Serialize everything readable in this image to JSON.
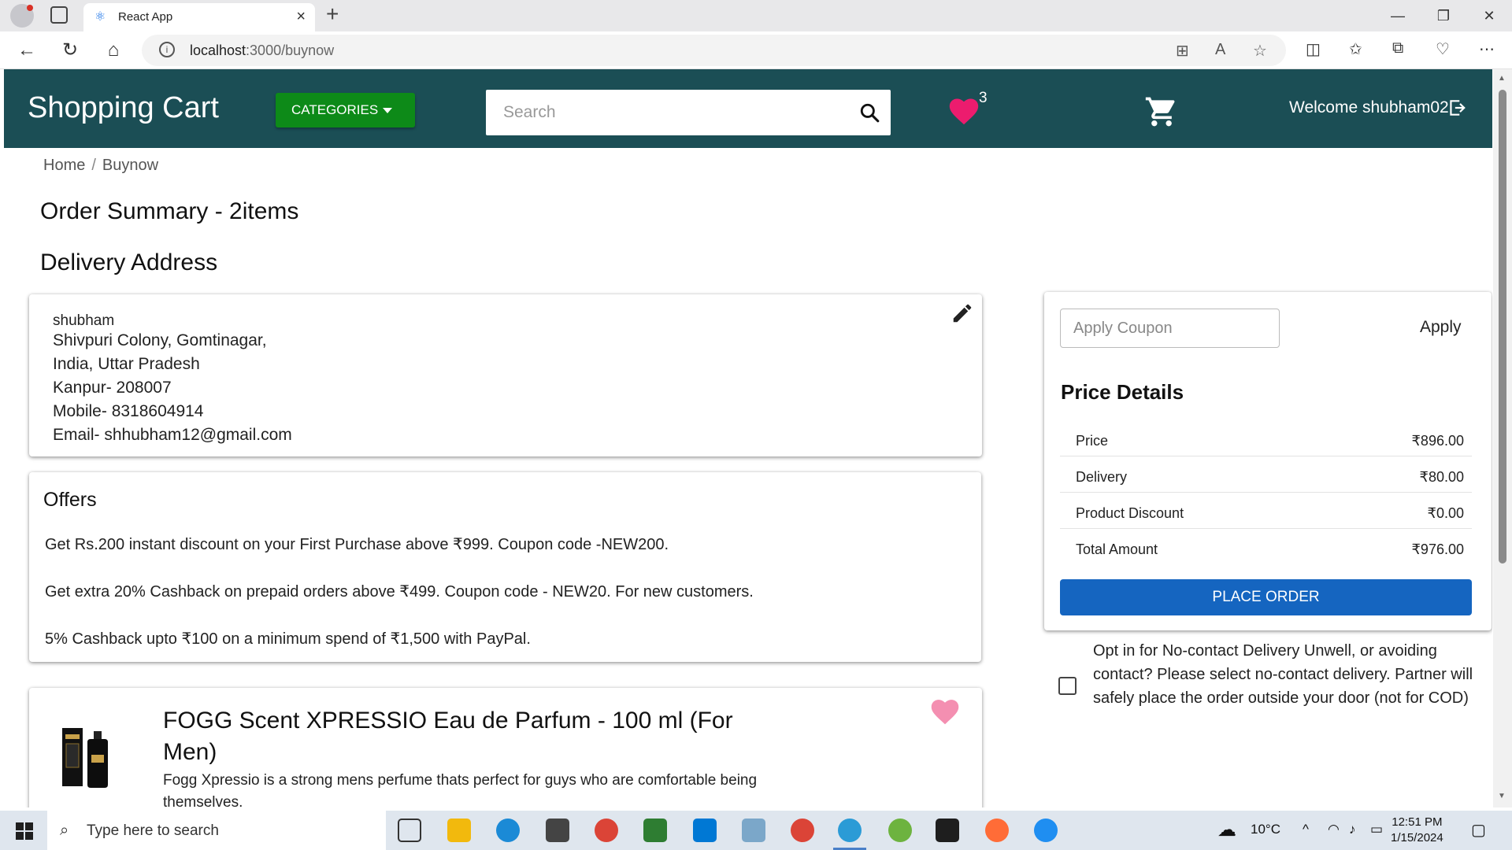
{
  "browser": {
    "tab_title": "React App",
    "url_host": "localhost",
    "url_path": ":3000/buynow"
  },
  "header": {
    "brand": "Shopping Cart",
    "categories_label": "CATEGORIES",
    "search_placeholder": "Search",
    "wishlist_count": "3",
    "welcome": "Welcome shubham02"
  },
  "breadcrumb": {
    "home": "Home",
    "current": "Buynow"
  },
  "order_summary_title": "Order Summary - 2items",
  "delivery_title": "Delivery Address",
  "address": {
    "name": "shubham",
    "line1": "Shivpuri Colony, Gomtinagar,",
    "line2": "India, Uttar Pradesh",
    "line3": "Kanpur- 208007",
    "mobile": "Mobile- 8318604914",
    "email": "Email- shhubham12@gmail.com"
  },
  "offers": {
    "title": "Offers",
    "items": [
      "Get Rs.200 instant discount on your First Purchase above ₹999. Coupon code -NEW200.",
      "Get extra 20% Cashback on prepaid orders above ₹499. Coupon code - NEW20. For new customers.",
      "5% Cashback upto ₹100 on a minimum spend of ₹1,500 with PayPal."
    ]
  },
  "product": {
    "title": "FOGG Scent XPRESSIO Eau de Parfum - 100 ml (For Men)",
    "description": "Fogg Xpressio is a strong mens perfume thats perfect for guys who are comfortable being themselves."
  },
  "price_panel": {
    "coupon_placeholder": "Apply Coupon",
    "apply_label": "Apply",
    "title": "Price Details",
    "rows": [
      {
        "label": "Price",
        "value": "₹896.00"
      },
      {
        "label": "Delivery",
        "value": "₹80.00"
      },
      {
        "label": "Product Discount",
        "value": "₹0.00"
      },
      {
        "label": "Total Amount",
        "value": "₹976.00"
      }
    ],
    "place_order": "PLACE ORDER"
  },
  "no_contact_text": "Opt in for No-contact Delivery Unwell, or avoiding contact? Please select no-contact delivery. Partner will safely place the order outside your door (not for COD)",
  "taskbar": {
    "search_text": "Type here to search",
    "weather": "10°C",
    "time": "12:51 PM",
    "date": "1/15/2024"
  },
  "colors": {
    "header_bg": "#1b4e55",
    "categories_btn": "#0d8a18",
    "place_order_btn": "#1565c0",
    "wishlist_heart": "#ec1c6e"
  }
}
